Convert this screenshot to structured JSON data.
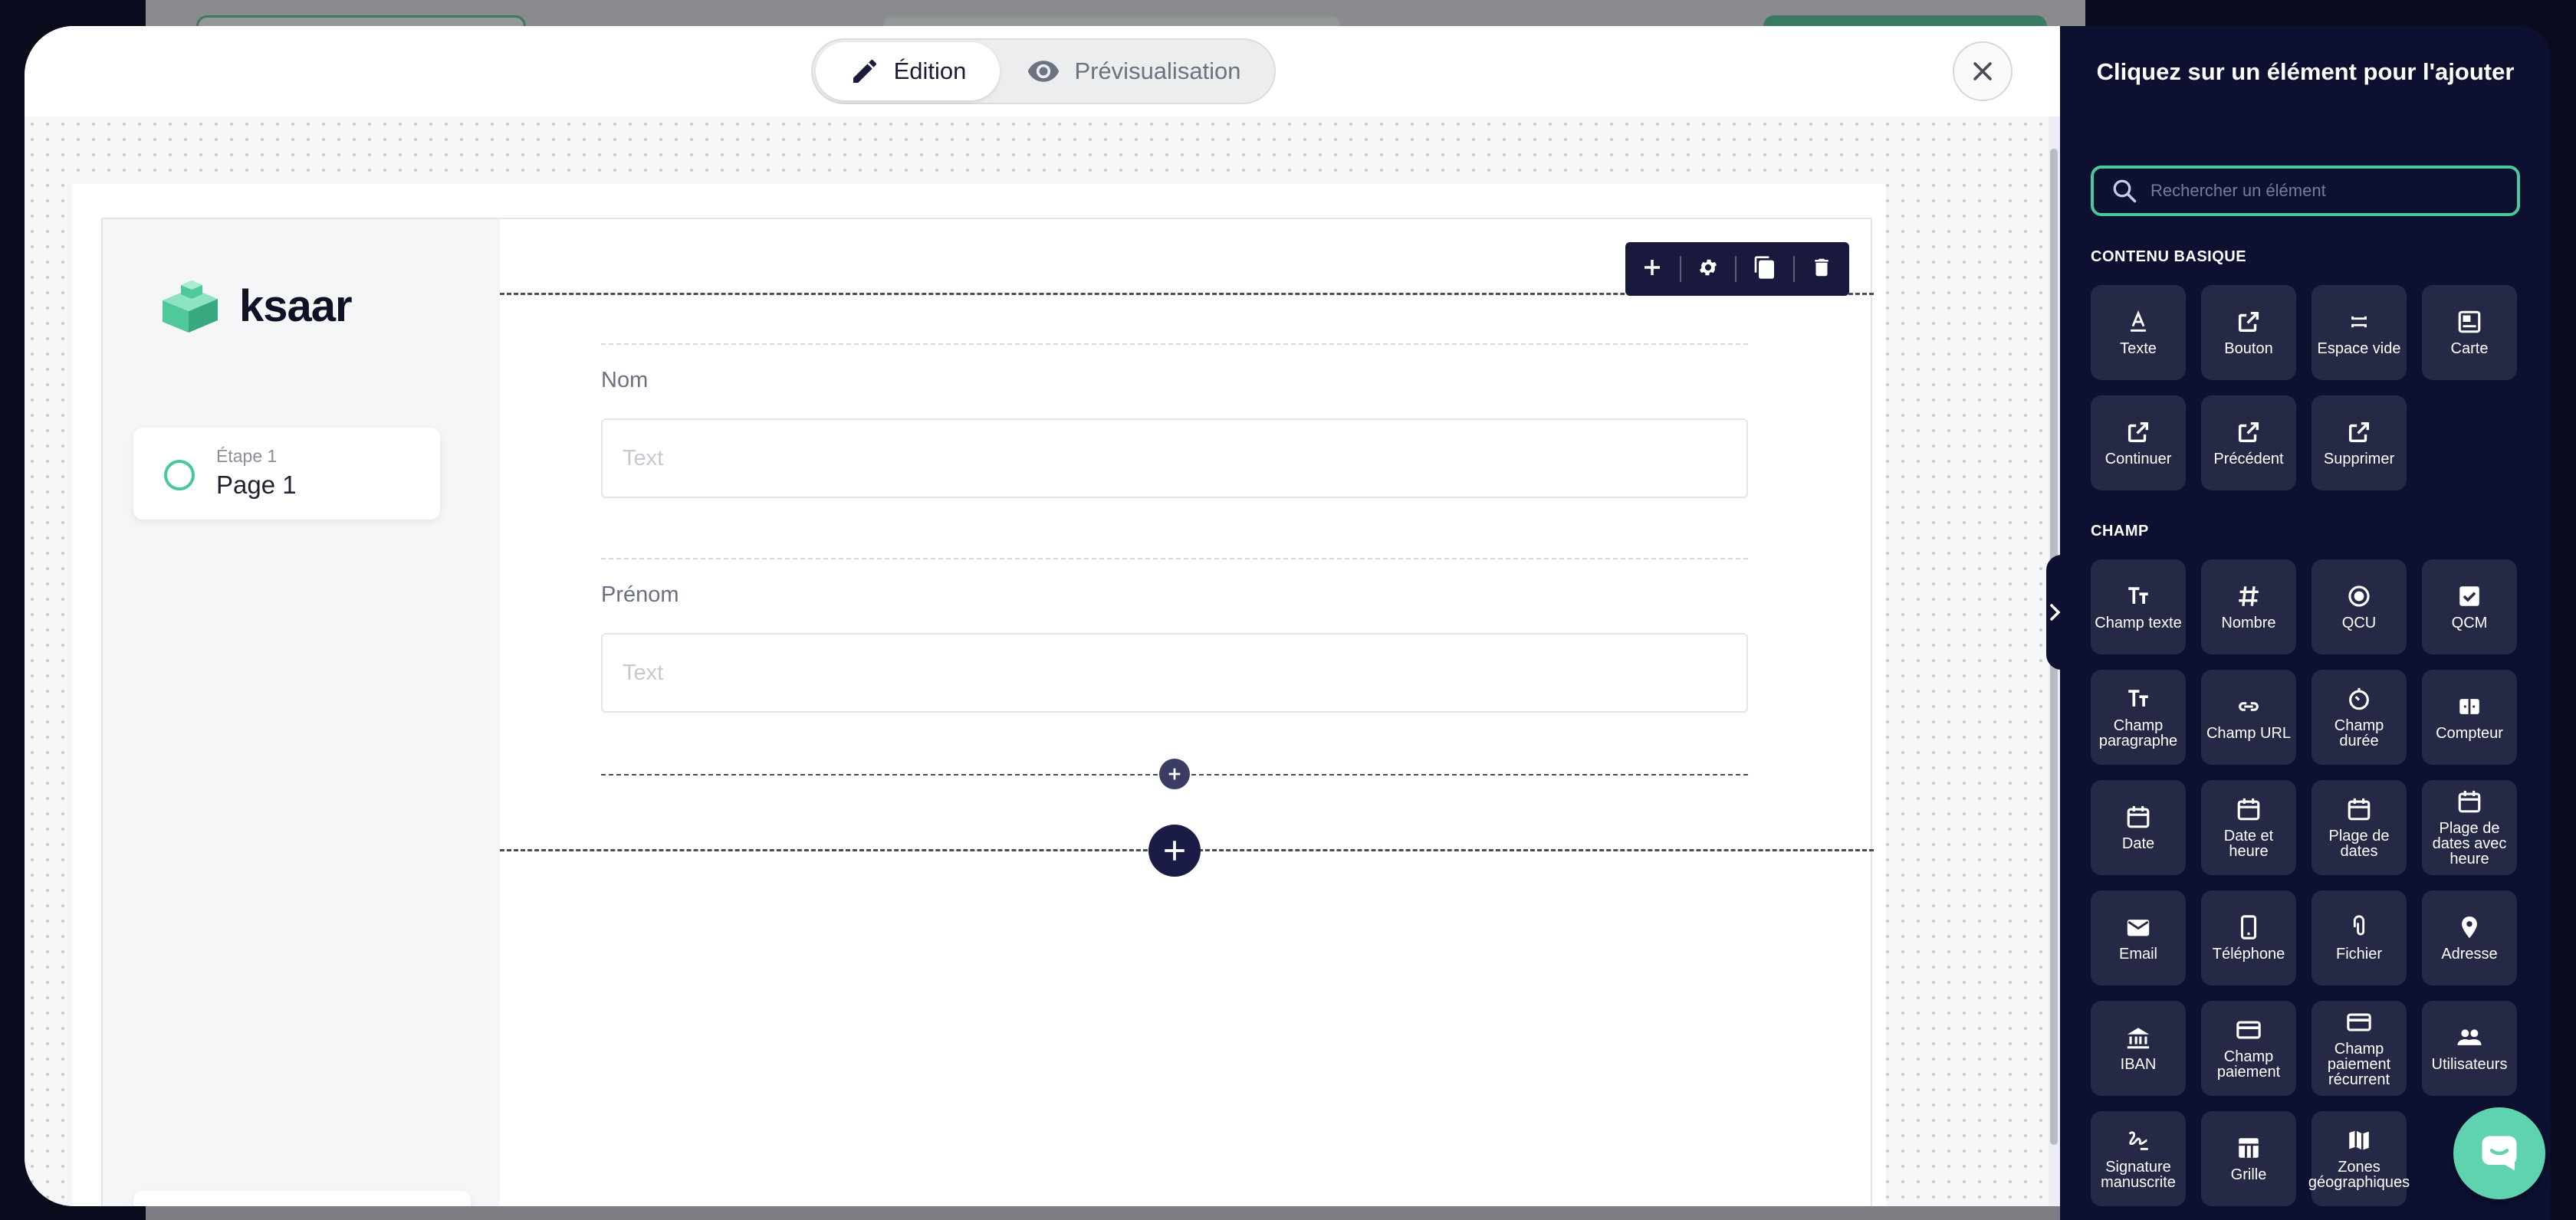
{
  "mode_toggle": {
    "edit_label": "Édition",
    "preview_label": "Prévisualisation"
  },
  "form": {
    "logo_text": "ksaar",
    "step": {
      "sub": "Étape 1",
      "title": "Page 1"
    },
    "fields": [
      {
        "label": "Nom",
        "placeholder": "Text"
      },
      {
        "label": "Prénom",
        "placeholder": "Text"
      }
    ]
  },
  "panel": {
    "title": "Cliquez sur un élément pour l'ajouter",
    "search_placeholder": "Rechercher un élément",
    "sections": [
      {
        "title": "CONTENU BASIQUE",
        "items": [
          {
            "label": "Texte",
            "icon": "text-icon"
          },
          {
            "label": "Bouton",
            "icon": "external-link-icon"
          },
          {
            "label": "Espace vide",
            "icon": "space-icon"
          },
          {
            "label": "Carte",
            "icon": "card-icon"
          },
          {
            "label": "Continuer",
            "icon": "external-link-icon"
          },
          {
            "label": "Précédent",
            "icon": "external-link-icon"
          },
          {
            "label": "Supprimer",
            "icon": "external-link-icon"
          }
        ]
      },
      {
        "title": "CHAMP",
        "items": [
          {
            "label": "Champ texte",
            "icon": "text-field-icon"
          },
          {
            "label": "Nombre",
            "icon": "hash-icon"
          },
          {
            "label": "QCU",
            "icon": "radio-icon"
          },
          {
            "label": "QCM",
            "icon": "checkbox-icon"
          },
          {
            "label": "Champ paragraphe",
            "icon": "paragraph-icon"
          },
          {
            "label": "Champ URL",
            "icon": "link-icon"
          },
          {
            "label": "Champ durée",
            "icon": "timer-icon"
          },
          {
            "label": "Compteur",
            "icon": "counter-icon"
          },
          {
            "label": "Date",
            "icon": "calendar-icon"
          },
          {
            "label": "Date et heure",
            "icon": "calendar-icon"
          },
          {
            "label": "Plage de dates",
            "icon": "calendar-icon"
          },
          {
            "label": "Plage de dates avec heure",
            "icon": "calendar-icon"
          },
          {
            "label": "Email",
            "icon": "mail-icon"
          },
          {
            "label": "Téléphone",
            "icon": "phone-icon"
          },
          {
            "label": "Fichier",
            "icon": "paperclip-icon"
          },
          {
            "label": "Adresse",
            "icon": "pin-icon"
          },
          {
            "label": "IBAN",
            "icon": "bank-icon"
          },
          {
            "label": "Champ paiement",
            "icon": "credit-card-icon"
          },
          {
            "label": "Champ paiement récurrent",
            "icon": "credit-card-icon"
          },
          {
            "label": "Utilisateurs",
            "icon": "users-icon"
          },
          {
            "label": "Signature manuscrite",
            "icon": "signature-icon"
          },
          {
            "label": "Grille",
            "icon": "grid-icon"
          },
          {
            "label": "Zones géographiques",
            "icon": "map-icon"
          }
        ]
      }
    ]
  },
  "colors": {
    "accent": "#49c89c",
    "panel_bg": "#0d1030",
    "tile_bg": "#262945",
    "toolbar_bg": "#19193e"
  }
}
